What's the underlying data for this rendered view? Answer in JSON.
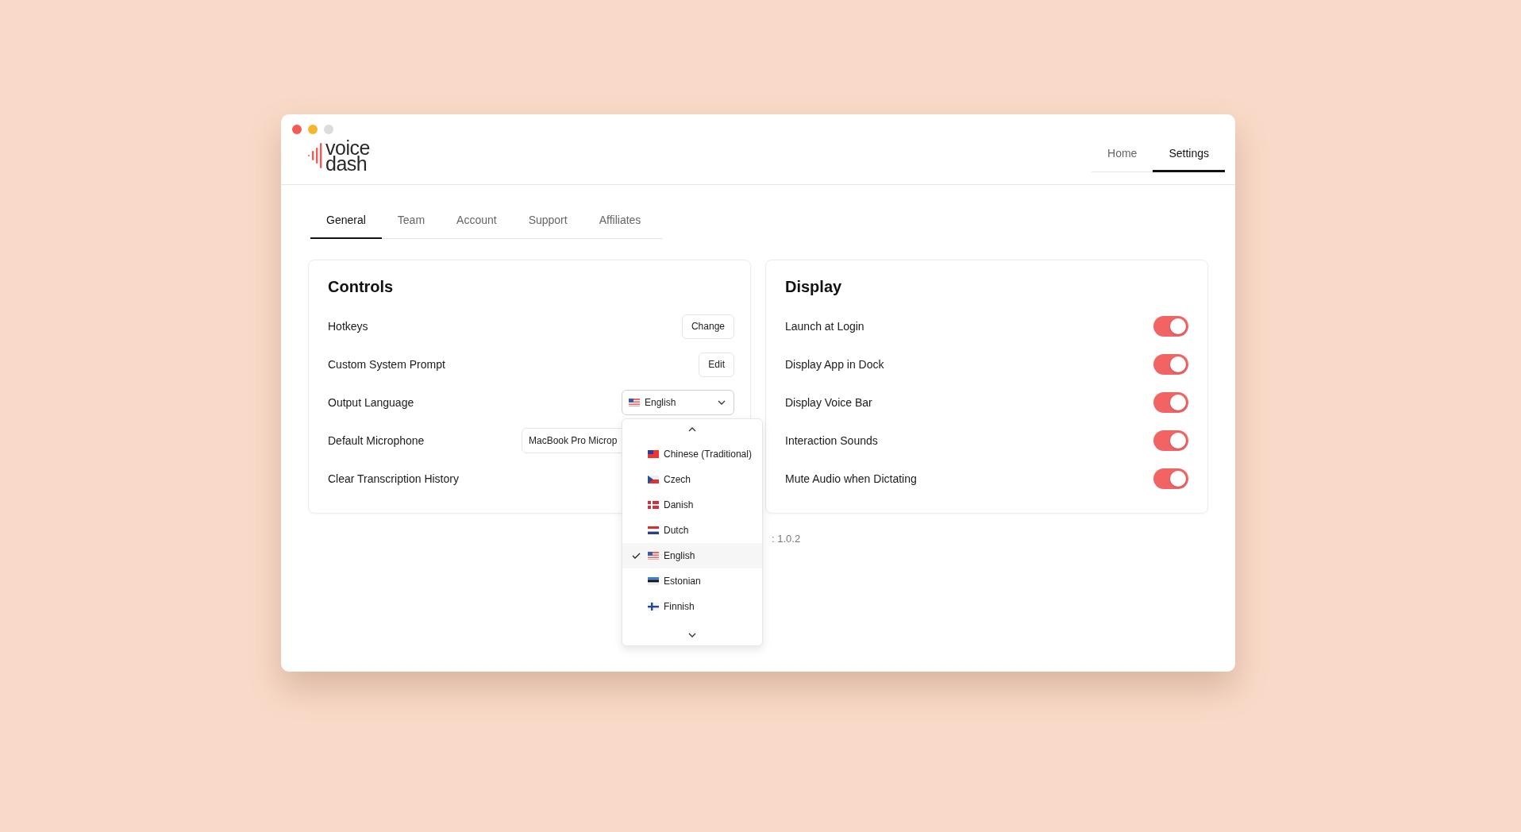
{
  "logo": {
    "line1": "voice",
    "line2": "dash"
  },
  "nav": [
    {
      "label": "Home",
      "selected": false
    },
    {
      "label": "Settings",
      "selected": true
    }
  ],
  "tabs": [
    {
      "label": "General",
      "selected": true
    },
    {
      "label": "Team",
      "selected": false
    },
    {
      "label": "Account",
      "selected": false
    },
    {
      "label": "Support",
      "selected": false
    },
    {
      "label": "Affiliates",
      "selected": false
    }
  ],
  "controls": {
    "title": "Controls",
    "rows": [
      {
        "label": "Hotkeys",
        "kind": "button",
        "value": "Change"
      },
      {
        "label": "Custom System Prompt",
        "kind": "button",
        "value": "Edit"
      },
      {
        "label": "Output Language",
        "kind": "language",
        "value": "English",
        "expanded": true
      },
      {
        "label": "Default Microphone",
        "kind": "select",
        "value": "MacBook Pro Microp"
      },
      {
        "label": "Clear Transcription History",
        "kind": "none"
      }
    ]
  },
  "language_menu": [
    {
      "label": "Chinese (Traditional)",
      "kind": "tw",
      "selected": false
    },
    {
      "label": "Czech",
      "kind": "cz",
      "selected": false
    },
    {
      "label": "Danish",
      "kind": "dk",
      "selected": false
    },
    {
      "label": "Dutch",
      "kind": "nl",
      "selected": false
    },
    {
      "label": "English",
      "kind": "us",
      "selected": true
    },
    {
      "label": "Estonian",
      "kind": "ee",
      "selected": false
    },
    {
      "label": "Finnish",
      "kind": "fi",
      "selected": false
    }
  ],
  "display": {
    "title": "Display",
    "rows": [
      {
        "label": "Launch at Login",
        "on": true
      },
      {
        "label": "Display App in Dock",
        "on": true
      },
      {
        "label": "Display Voice Bar",
        "on": true
      },
      {
        "label": "Interaction Sounds",
        "on": true
      },
      {
        "label": "Mute Audio when Dictating",
        "on": true
      }
    ]
  },
  "version": ": 1.0.2"
}
